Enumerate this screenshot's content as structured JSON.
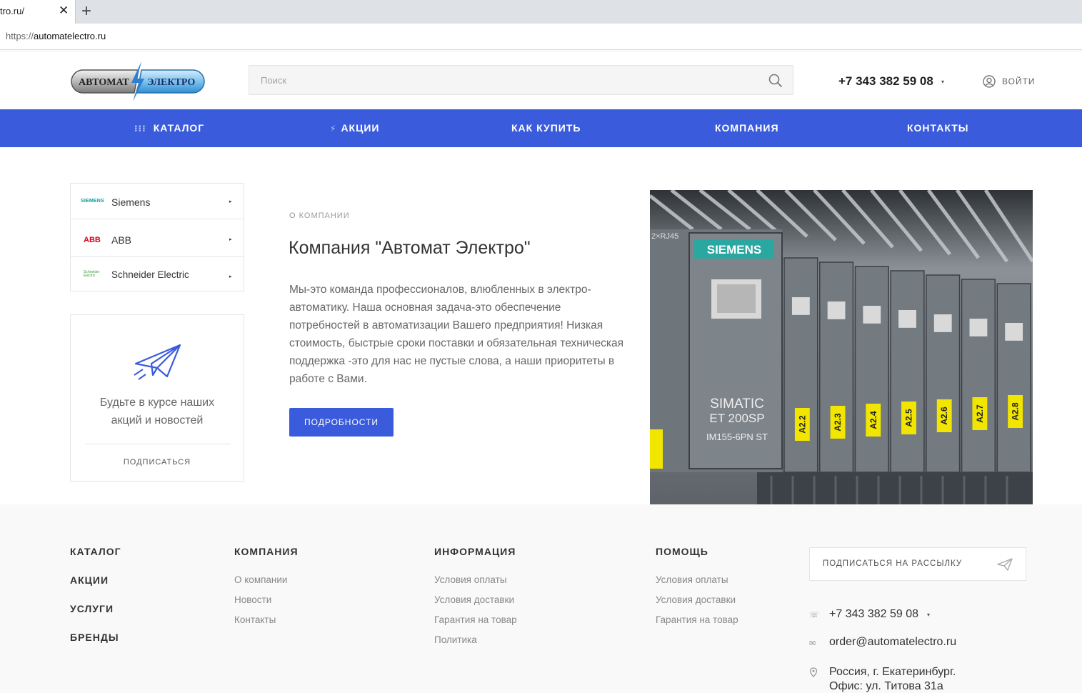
{
  "browser": {
    "tab_title": "tro.ru/",
    "close_glyph": "✕",
    "newtab_glyph": "+",
    "url_scheme": "https://",
    "url_host": "automatelectro.ru"
  },
  "header": {
    "logo_left": "АВТОМАТ",
    "logo_right": "ЭЛЕКТРО",
    "search_placeholder": "Поиск",
    "phone": "+7 343 382 59 08",
    "phone_caret": "▾",
    "login_label": "ВОЙТИ"
  },
  "nav": {
    "catalog": "КАТАЛОГ",
    "catalog_icon": "⁝⁝⁝",
    "promos": "АКЦИИ",
    "promos_icon": "⚡",
    "how_to_buy": "КАК КУПИТЬ",
    "company": "КОМПАНИЯ",
    "contacts": "КОНТАКТЫ"
  },
  "brands": {
    "items": [
      {
        "label": "Siemens",
        "logo": "SIEMENS"
      },
      {
        "label": "ABB",
        "logo": "ABB"
      },
      {
        "label": "Schneider Electric",
        "logo": "Schneider Electric"
      }
    ],
    "arrow": "▸"
  },
  "subscribe_box": {
    "text": "Будьте в курсе наших акций и новостей",
    "link": "ПОДПИСАТЬСЯ"
  },
  "about": {
    "kicker": "О КОМПАНИИ",
    "title": "Компания \"Автомат Электро\"",
    "text": "Мы-это команда профессионалов, влюбленных в электро-автоматику. Наша основная задача-это обеспечение потребностей в автоматизации Вашего предприятия! Низкая стоимость, быстрые сроки поставки и обязательная техническая поддержка -это для нас не пустые слова, а наши приоритеты в работе с Вами.",
    "button": "ПОДРОБНОСТИ"
  },
  "photo": {
    "brand": "SIEMENS",
    "model1": "SIMATIC",
    "model2": "ET 200SP",
    "model3": "IM155-6PN ST",
    "port": "2×RJ45",
    "labels": [
      "A2.2",
      "A2.3",
      "A2.4",
      "A2.5",
      "A2.6",
      "A2.7",
      "A2.8"
    ]
  },
  "footer": {
    "col1": [
      "КАТАЛОГ",
      "АКЦИИ",
      "УСЛУГИ",
      "БРЕНДЫ"
    ],
    "company_head": "КОМПАНИЯ",
    "company_links": [
      "О компании",
      "Новости",
      "Контакты"
    ],
    "info_head": "ИНФОРМАЦИЯ",
    "info_links": [
      "Условия оплаты",
      "Условия доставки",
      "Гарантия на товар",
      "Политика"
    ],
    "help_head": "ПОМОЩЬ",
    "help_links": [
      "Условия оплаты",
      "Условия доставки",
      "Гарантия на товар"
    ],
    "newsletter": "ПОДПИСАТЬСЯ НА РАССЫЛКУ",
    "phone": "+7 343 382 59 08",
    "phone_caret": "▾",
    "email": "order@automatelectro.ru",
    "address_line1": "Россия, г. Екатеринбург.",
    "address_line2": "Офис: ул. Титова 31а"
  },
  "colors": {
    "accent": "#3a5bdc",
    "footer_bg": "#f9f9f9"
  }
}
